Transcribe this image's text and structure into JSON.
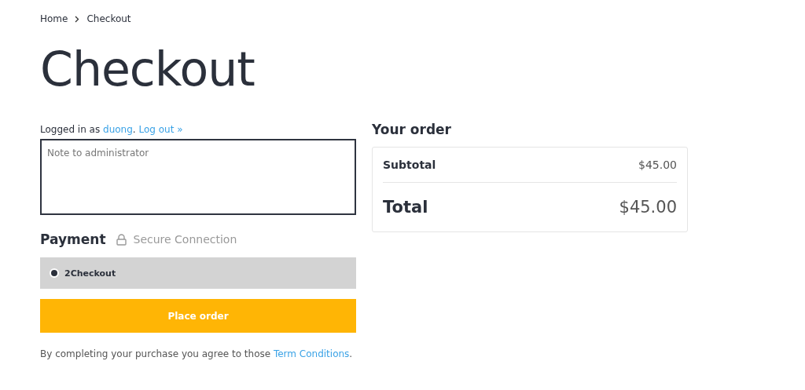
{
  "breadcrumb": [
    {
      "label": "Home"
    },
    {
      "label": "Checkout"
    }
  ],
  "title": "Checkout",
  "login": {
    "prefix": "Logged in as ",
    "user": "duong",
    "separator": ". ",
    "logout": "Log out »"
  },
  "note": {
    "placeholder": "Note to administrator"
  },
  "payment": {
    "title": "Payment",
    "secure": "Secure Connection",
    "methods": [
      {
        "label": "2Checkout",
        "selected": true
      }
    ]
  },
  "place_order": "Place order",
  "terms": {
    "text": "By completing your purchase you agree to those ",
    "link": "Term Conditions",
    "suffix": "."
  },
  "order": {
    "title": "Your order",
    "rows": [
      {
        "kind": "subtotal",
        "label": "Subtotal",
        "value": "$45.00"
      },
      {
        "kind": "total",
        "label": "Total",
        "value": "$45.00"
      }
    ]
  }
}
